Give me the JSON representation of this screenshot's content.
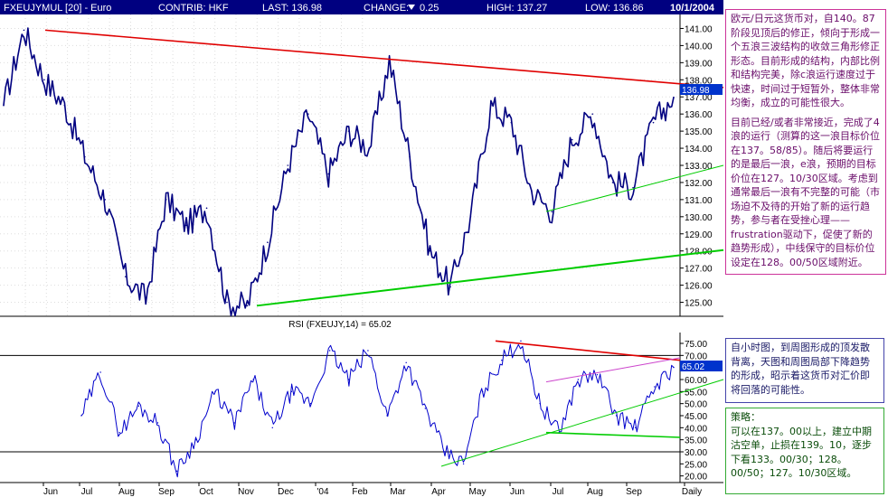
{
  "header": {
    "symbol": "FXEUJYMUL [20] - Euro",
    "contrib_label": "CONTRIB: HKF",
    "last_label": "LAST: 136.98",
    "change_label": "CHANGE:",
    "change_value": "0.25",
    "high_label": "HIGH: 137.27",
    "low_label": "LOW: 136.86",
    "date": "10/1/2004"
  },
  "price_panel": {
    "last_tag": "136.98",
    "y_ticks": [
      "141.00",
      "140.00",
      "139.00",
      "138.00",
      "137.00",
      "136.00",
      "135.00",
      "134.00",
      "133.00",
      "132.00",
      "131.00",
      "130.00",
      "129.00",
      "128.00",
      "127.00",
      "126.00",
      "125.00"
    ]
  },
  "rsi_panel": {
    "title": "RSI (FXEUJY,14) = 65.02",
    "last_tag": "65.02",
    "y_ticks": [
      "75.00",
      "70.00",
      "65.00",
      "60.00",
      "55.00",
      "50.00",
      "45.00",
      "40.00",
      "35.00",
      "30.00",
      "25.00",
      "20.00"
    ]
  },
  "x_axis": {
    "labels": [
      "Jun",
      "Jul",
      "Aug",
      "Sep",
      "Oct",
      "Nov",
      "Dec",
      "'04",
      "Feb",
      "Mar",
      "Apr",
      "May",
      "Jun",
      "Jul",
      "Aug",
      "Sep",
      "Daily"
    ]
  },
  "notes": {
    "wave_p1": "欧元/日元这货币对，自140。87阶段见顶后的修正，倾向于形成一个五浪三波结构的收敛三角形修正形态。目前形成的结构，内部比例和结构完美，除c浪运行速度过于快速，时间过于短暂外，整体非常均衡，成立的可能性很大。",
    "wave_p2": "目前已经/或者非常接近，完成了4浪的运行（测算的这一浪目标价位在137。58/85）。随后将要运行的是最后一浪，e浪，预期的目标价位在127。10/30区域。考虑到通常最后一浪有不完整的可能（市场迫不及待的开始了新的运行趋势，参与者在受挫心理——frustration驱动下，促使了新的趋势形成），中线保守的目标价位设定在128。00/50区域附近。",
    "rsi": "自小时图，到周图形成的顶发散背离，天图和周图局部下降趋势的形成，昭示着这货币对汇价即将回落的可能性。",
    "strategy": "策略：\n可以在137。00以上，建立中期沽空单，止损在139。10，逐步下看133。00/30；128。00/50；127。10/30区域。"
  },
  "colors": {
    "price_line": "#000080",
    "rsi_line": "#0000cc",
    "resistance": "#e00000",
    "support": "#00cc00",
    "channel": "#cc44cc",
    "header_bg": "#000080",
    "tag_bg": "#0033cc"
  },
  "chart_data": [
    {
      "type": "line",
      "title": "FXEUJYMUL [20] - Euro",
      "x": [
        "May 2003",
        "Jun 2003",
        "Jun 2003",
        "Jul 2003",
        "Jul 2003",
        "Aug 2003",
        "Aug 2003",
        "Sep 2003",
        "Sep 2003",
        "Oct 2003",
        "Oct 2003",
        "Nov 2003",
        "Nov 2003",
        "Dec 2003",
        "Dec 2003",
        "Jan 2004",
        "Jan 2004",
        "Feb 2004",
        "Feb 2004",
        "Mar 2004",
        "Mar 2004",
        "Apr 2004",
        "Apr 2004",
        "May 2004",
        "May 2004",
        "Jun 2004",
        "Jun 2004",
        "Jul 2004",
        "Jul 2004",
        "Aug 2004",
        "Aug 2004",
        "Sep 2004",
        "Sep 2004",
        "Oct 2004"
      ],
      "series": [
        {
          "values": [
            136.5,
            140.9,
            138.0,
            136.5,
            133.5,
            131.0,
            126.5,
            125.2,
            131.0,
            129.5,
            130.5,
            125.0,
            124.8,
            128.5,
            133.0,
            136.0,
            132.5,
            135.0,
            134.0,
            139.1,
            133.5,
            128.0,
            125.9,
            130.0,
            136.5,
            135.5,
            131.5,
            130.3,
            134.5,
            136.0,
            132.0,
            131.7,
            135.5,
            136.98
          ]
        }
      ],
      "ylim": [
        124.5,
        141.5
      ]
    },
    {
      "type": "line",
      "title": "RSI (FXEUJY,14) = 65.02",
      "x": [
        "Jun 2003",
        "Jul 2003",
        "Jul 2003",
        "Aug 2003",
        "Aug 2003",
        "Sep 2003",
        "Sep 2003",
        "Oct 2003",
        "Oct 2003",
        "Nov 2003",
        "Nov 2003",
        "Dec 2003",
        "Dec 2003",
        "Jan 2004",
        "Jan 2004",
        "Feb 2004",
        "Feb 2004",
        "Mar 2004",
        "Mar 2004",
        "Apr 2004",
        "Apr 2004",
        "May 2004",
        "May 2004",
        "Jun 2004",
        "Jun 2004",
        "Jul 2004",
        "Jul 2004",
        "Aug 2004",
        "Aug 2004",
        "Sep 2004",
        "Sep 2004",
        "Oct 2004"
      ],
      "series": [
        {
          "values": [
            45,
            63,
            38,
            49,
            42,
            22,
            35,
            55,
            42,
            60,
            40,
            55,
            50,
            72,
            60,
            72,
            45,
            67,
            48,
            30,
            25,
            55,
            68,
            76,
            50,
            38,
            60,
            62,
            45,
            40,
            57,
            65.02
          ]
        }
      ],
      "ylim": [
        18,
        78
      ]
    }
  ]
}
